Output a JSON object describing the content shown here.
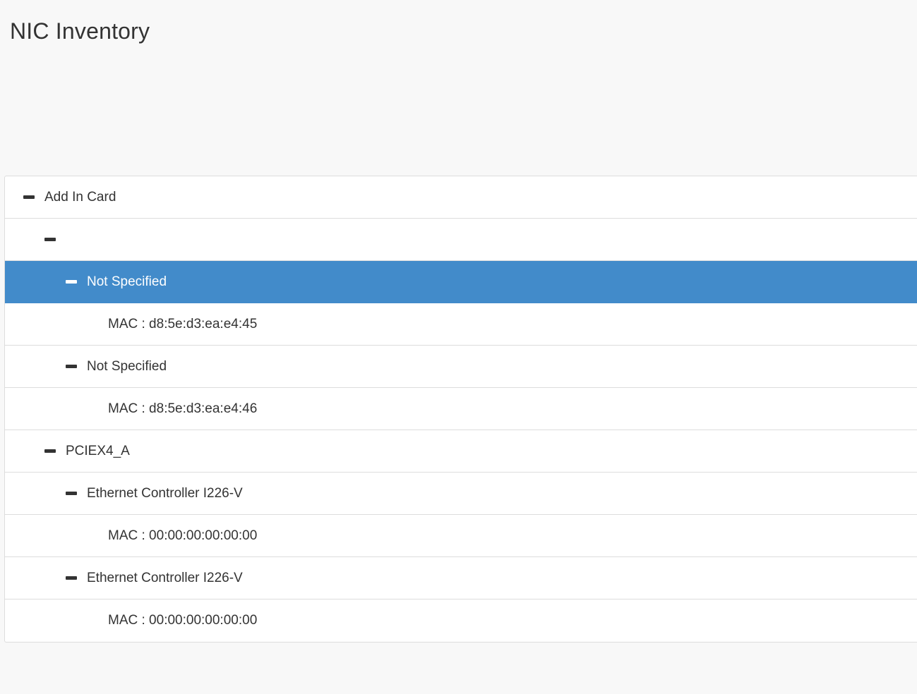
{
  "page": {
    "title": "NIC Inventory"
  },
  "tree": {
    "nodes": [
      {
        "label": "Add In Card",
        "level": 0,
        "toggle": "minus",
        "selected": false
      },
      {
        "label": "",
        "level": 1,
        "toggle": "minus",
        "selected": false
      },
      {
        "label": "Not Specified",
        "level": 2,
        "toggle": "minus",
        "selected": true
      },
      {
        "label": "MAC : d8:5e:d3:ea:e4:45",
        "level": 3,
        "toggle": "none",
        "selected": false
      },
      {
        "label": "Not Specified",
        "level": 2,
        "toggle": "minus",
        "selected": false
      },
      {
        "label": "MAC : d8:5e:d3:ea:e4:46",
        "level": 3,
        "toggle": "none",
        "selected": false
      },
      {
        "label": "PCIEX4_A",
        "level": 1,
        "toggle": "minus",
        "selected": false
      },
      {
        "label": "Ethernet Controller I226-V",
        "level": 2,
        "toggle": "minus",
        "selected": false
      },
      {
        "label": "MAC : 00:00:00:00:00:00",
        "level": 3,
        "toggle": "none",
        "selected": false
      },
      {
        "label": "Ethernet Controller I226-V",
        "level": 2,
        "toggle": "minus",
        "selected": false
      },
      {
        "label": "MAC : 00:00:00:00:00:00",
        "level": 3,
        "toggle": "none",
        "selected": false
      }
    ]
  },
  "colors": {
    "background": "#f8f8f8",
    "selected": "#428bca",
    "text": "#333333",
    "border": "#dddddd"
  }
}
